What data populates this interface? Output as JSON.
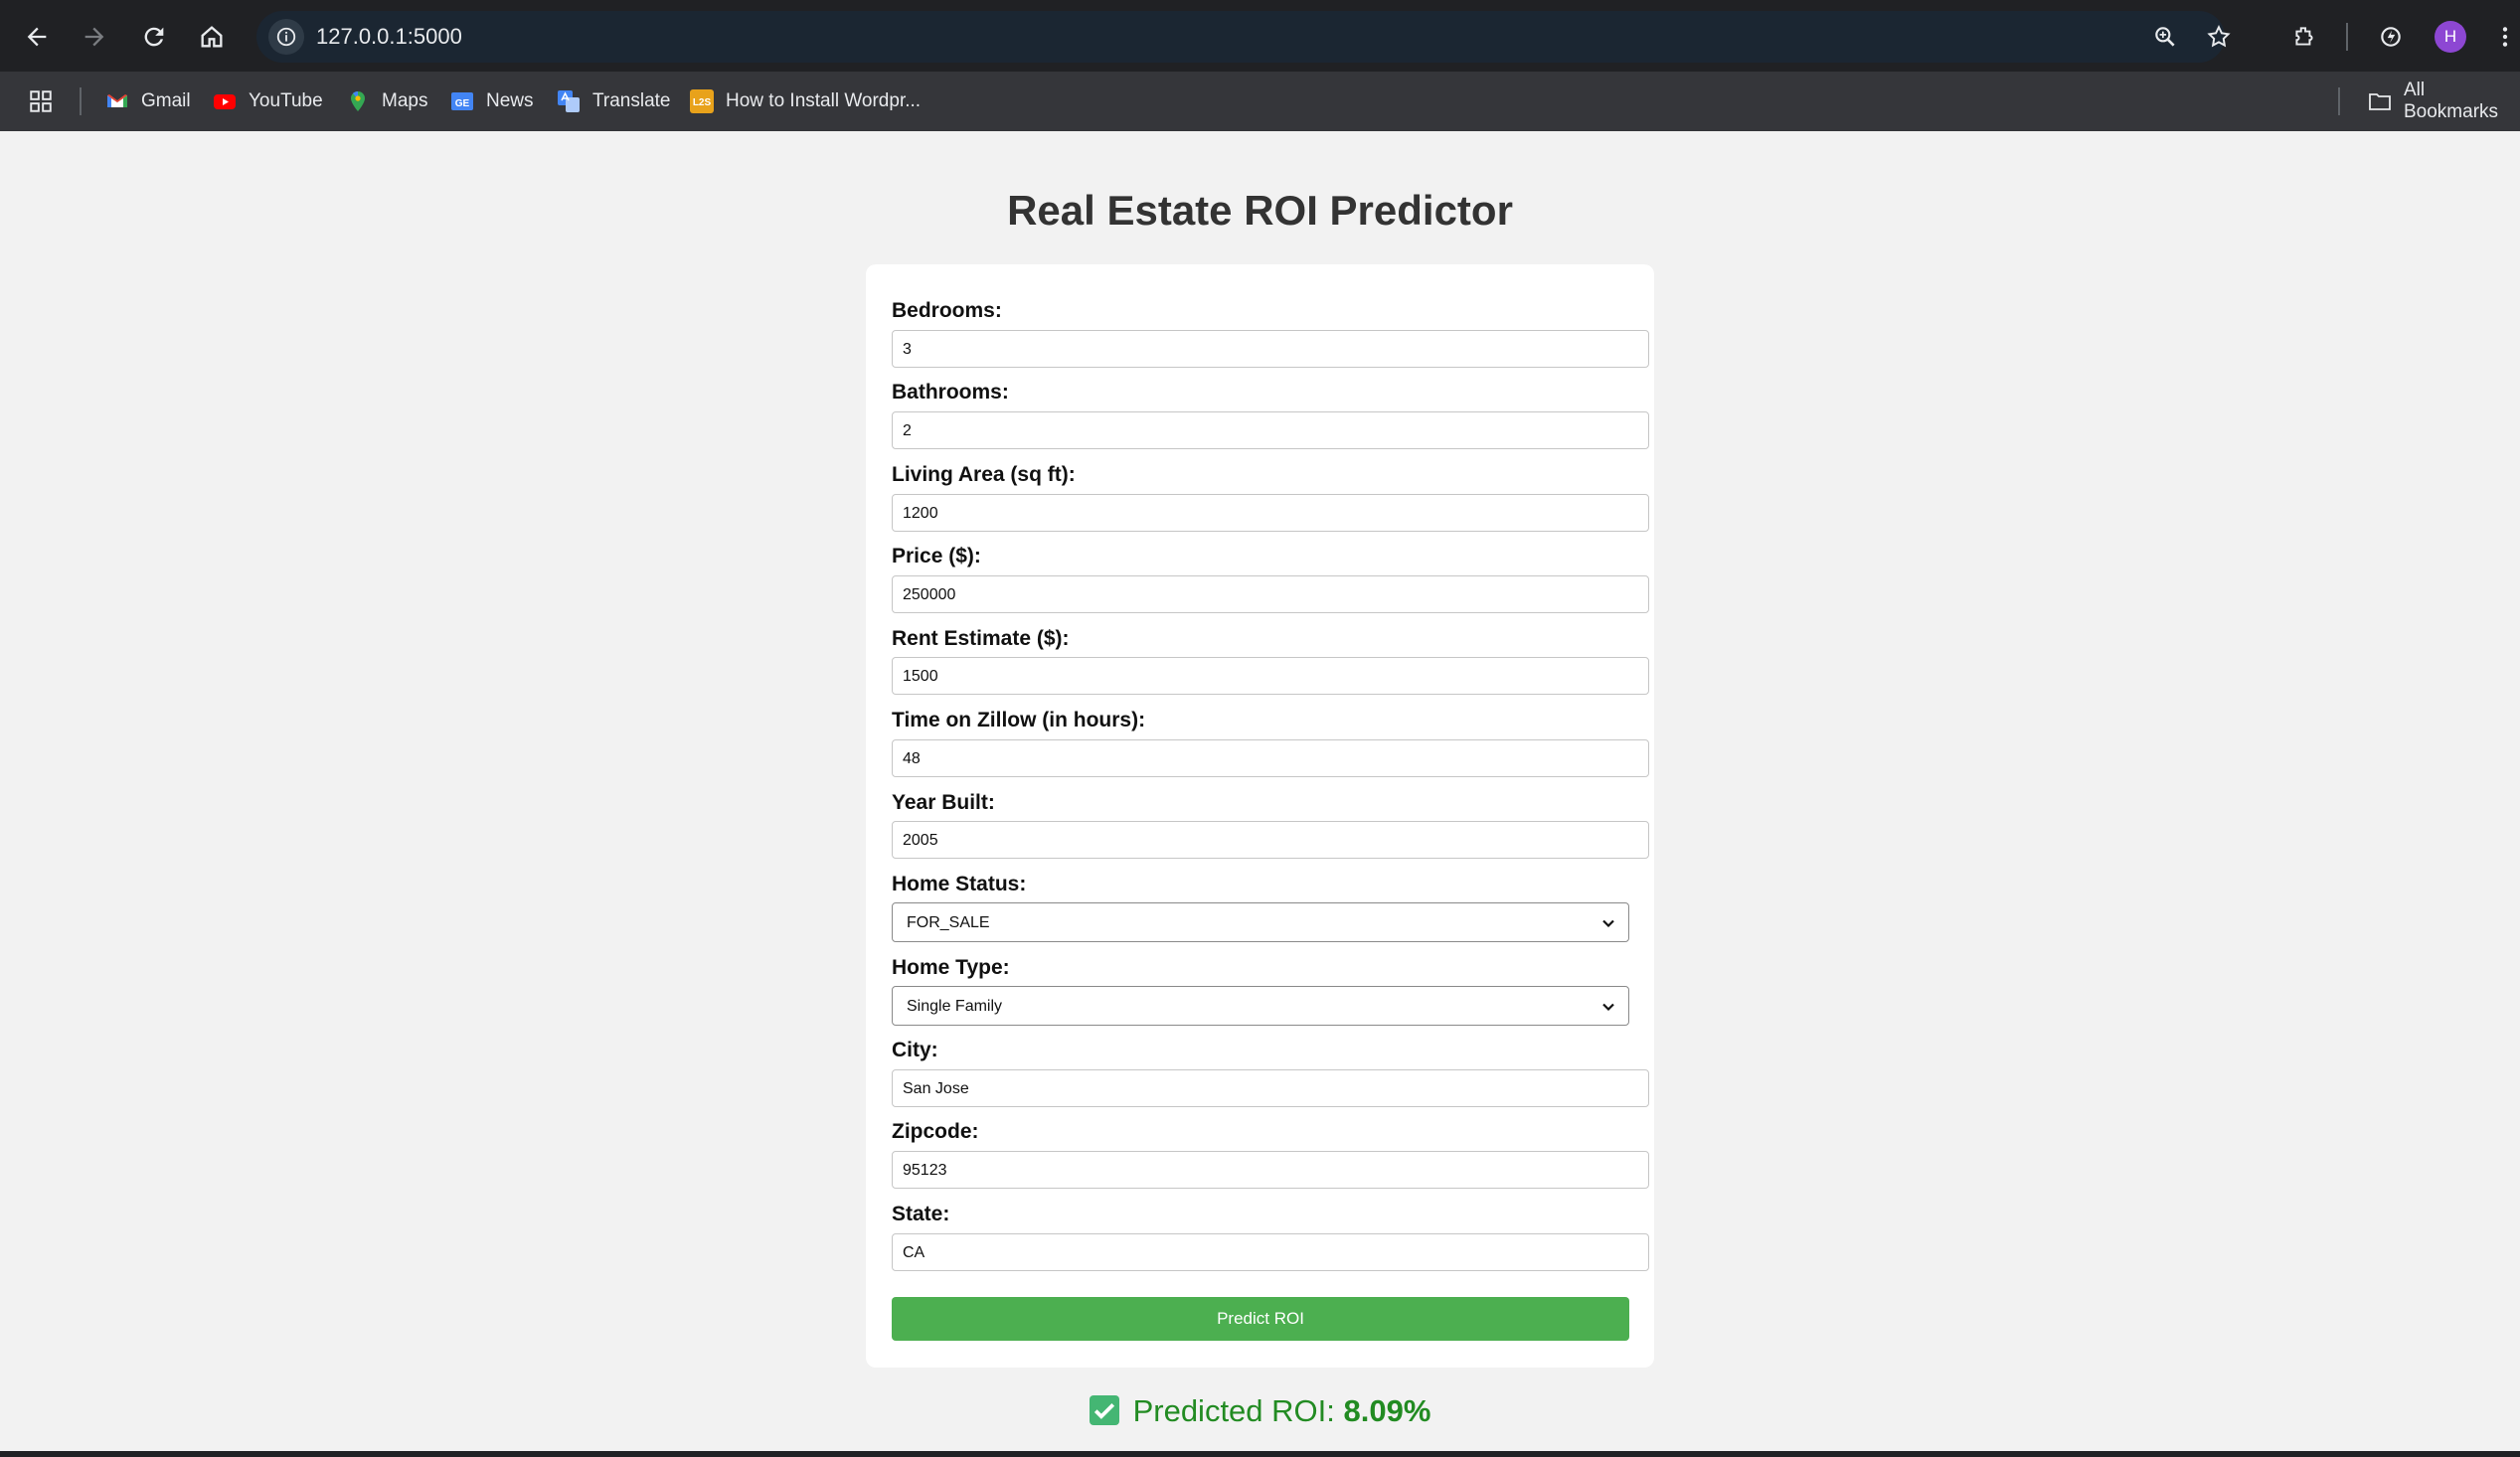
{
  "browser": {
    "url": "127.0.0.1:5000",
    "profile_initial": "H",
    "bookmarks": [
      {
        "label": "Gmail",
        "icon": "gmail-icon"
      },
      {
        "label": "YouTube",
        "icon": "youtube-icon"
      },
      {
        "label": "Maps",
        "icon": "maps-icon"
      },
      {
        "label": "News",
        "icon": "news-icon"
      },
      {
        "label": "Translate",
        "icon": "translate-icon"
      },
      {
        "label": "How to Install Wordpr...",
        "icon": "l2s-icon"
      }
    ],
    "all_bookmarks_label": "All Bookmarks",
    "l2s_glyph": "L2S",
    "news_glyph": "GE"
  },
  "page": {
    "title": "Real Estate ROI Predictor",
    "fields": [
      {
        "label": "Bedrooms:",
        "value": "3"
      },
      {
        "label": "Bathrooms:",
        "value": "2"
      },
      {
        "label": "Living Area (sq ft):",
        "value": "1200"
      },
      {
        "label": "Price ($):",
        "value": "250000"
      },
      {
        "label": "Rent Estimate ($):",
        "value": "1500"
      },
      {
        "label": "Time on Zillow (in hours):",
        "value": "48"
      },
      {
        "label": "Year Built:",
        "value": "2005"
      }
    ],
    "home_status": {
      "label": "Home Status:",
      "value": "FOR_SALE"
    },
    "home_type": {
      "label": "Home Type:",
      "value": "Single Family"
    },
    "city": {
      "label": "City:",
      "value": "San Jose"
    },
    "zipcode": {
      "label": "Zipcode:",
      "value": "95123"
    },
    "state": {
      "label": "State:",
      "value": "CA"
    },
    "predict_button": "Predict ROI",
    "result": {
      "prefix": "Predicted ROI:",
      "value": "8.09%"
    }
  },
  "colors": {
    "accent_button": "#4caf50",
    "result_text": "#228b22",
    "avatar": "#8d47d3"
  }
}
